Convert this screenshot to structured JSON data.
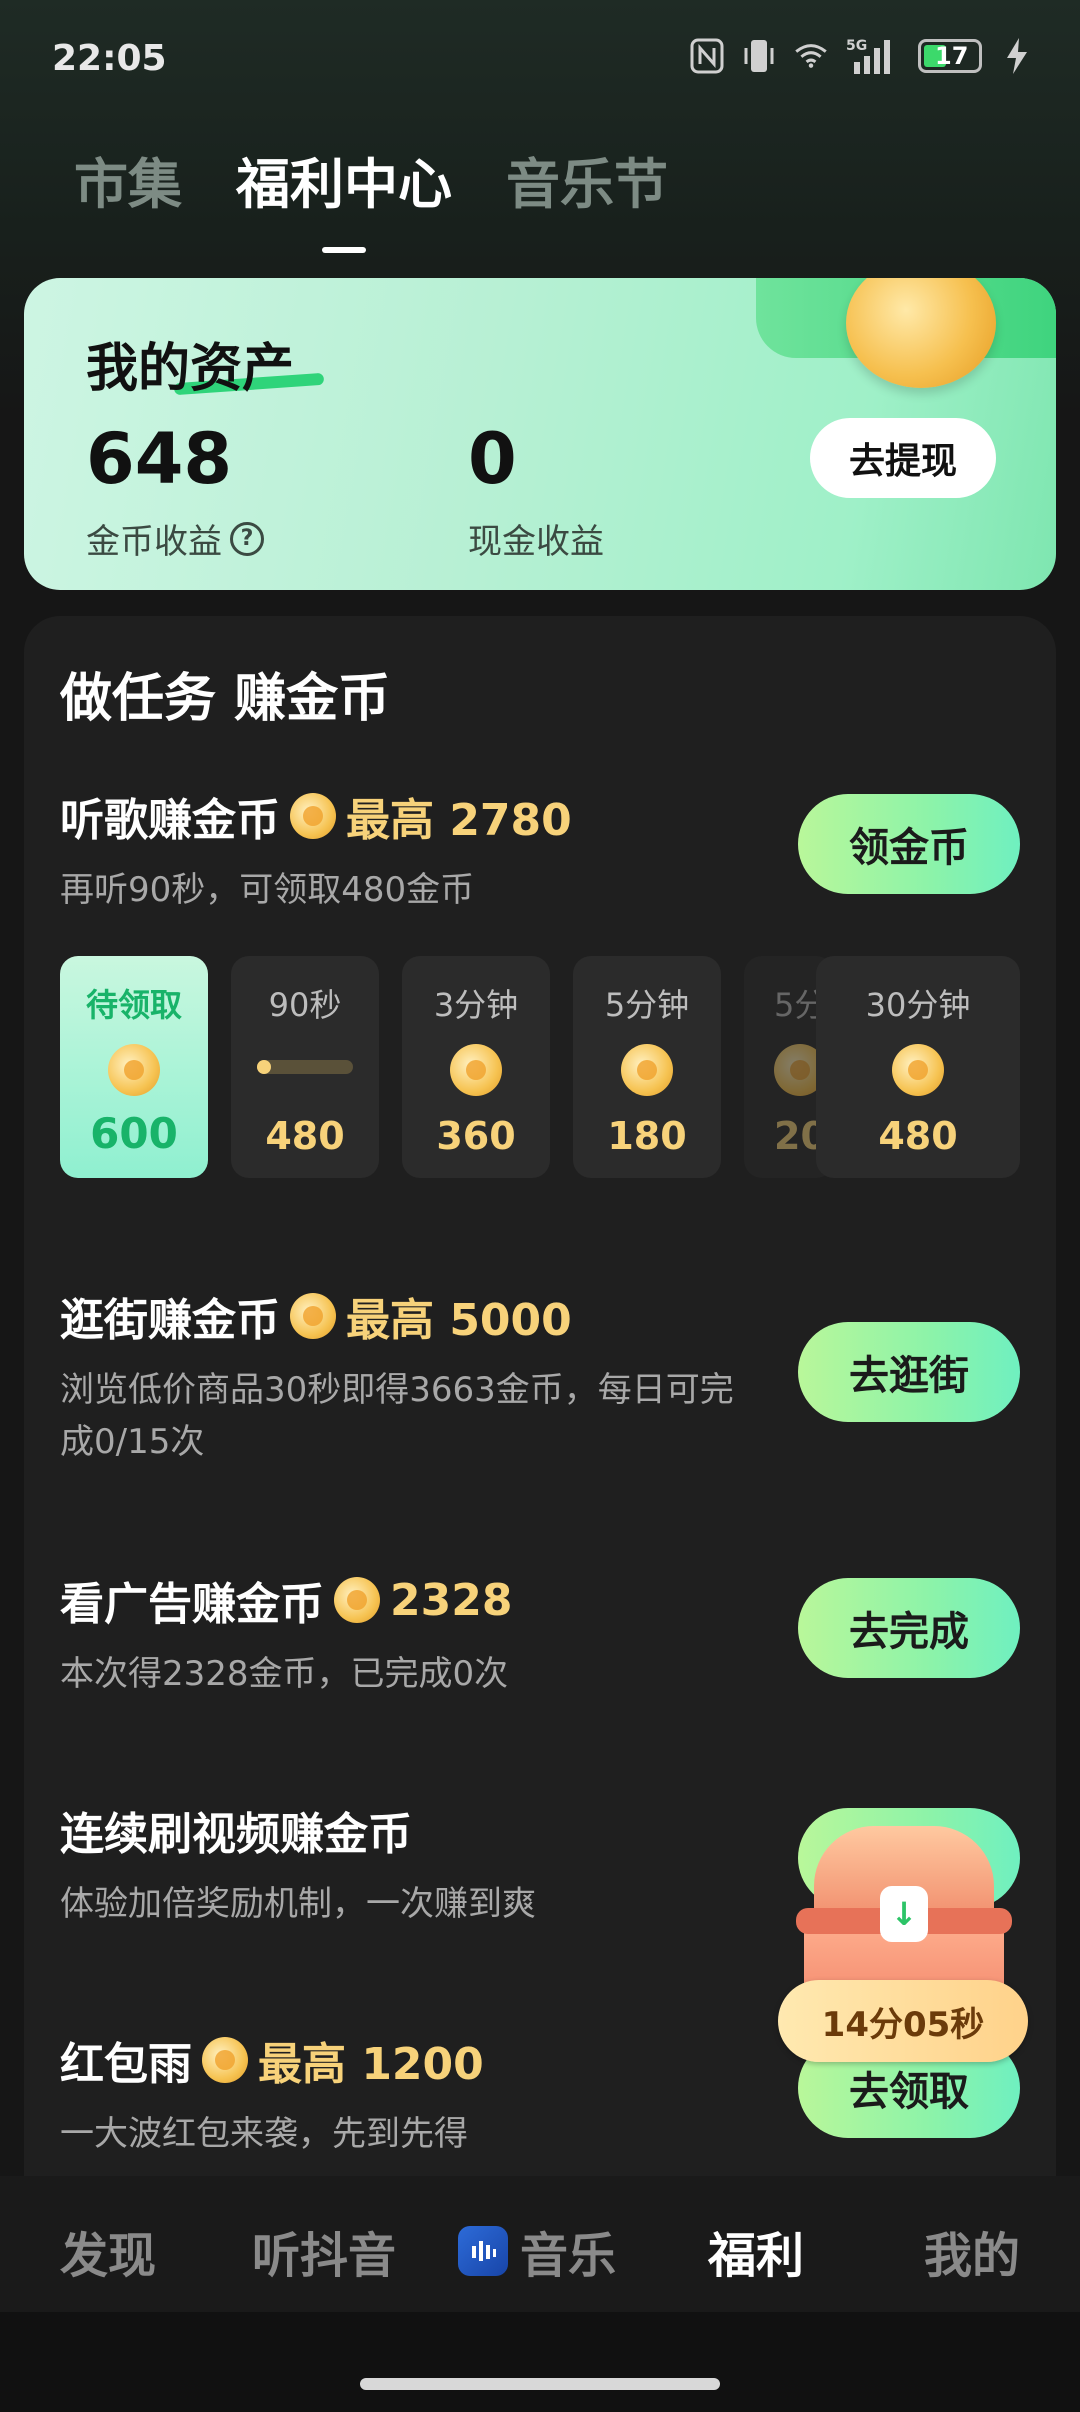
{
  "status_bar": {
    "time": "22:05",
    "network": "5G",
    "battery": "17"
  },
  "top_tabs": [
    "市集",
    "福利中心",
    "音乐节"
  ],
  "top_tabs_active": 1,
  "assets": {
    "title": "我的资产",
    "coins_value": "648",
    "coins_label": "金币收益",
    "cash_value": "0",
    "cash_label": "现金收益",
    "withdraw_label": "去提现"
  },
  "tasks_title": "做任务 赚金币",
  "tasks": {
    "listen": {
      "name": "听歌赚金币",
      "bonus": "最高 2780",
      "desc": "再听90秒，可领取480金币",
      "button": "领金币"
    },
    "shop": {
      "name": "逛街赚金币",
      "bonus": "最高 5000",
      "desc": "浏览低价商品30秒即得3663金币，每日可完成0/15次",
      "button": "去逛街"
    },
    "ads": {
      "name": "看广告赚金币",
      "bonus": "2328",
      "desc": "本次得2328金币，已完成0次",
      "button": "去完成"
    },
    "video": {
      "name": "连续刷视频赚金币",
      "desc": "体验加倍奖励机制，一次赚到爽"
    },
    "redpacket": {
      "name": "红包雨",
      "bonus": "最高 1200",
      "desc": "一大波红包来袭，先到先得",
      "button": "去领取"
    }
  },
  "timeline": [
    {
      "label": "待领取",
      "value": "600"
    },
    {
      "label": "90秒",
      "value": "480",
      "progress": 0.1
    },
    {
      "label": "3分钟",
      "value": "360"
    },
    {
      "label": "5分钟",
      "value": "180"
    },
    {
      "label": "5分",
      "value": "20"
    },
    {
      "label": "30分钟",
      "value": "480"
    }
  ],
  "treasure_timer": "14分05秒",
  "bottom_nav": [
    "发现",
    "听抖音",
    "音乐",
    "福利",
    "我的"
  ],
  "bottom_nav_active": 3,
  "colors": {
    "accent_green": "#8cf3a9",
    "gold": "#f7d27a",
    "background": "#161616"
  }
}
